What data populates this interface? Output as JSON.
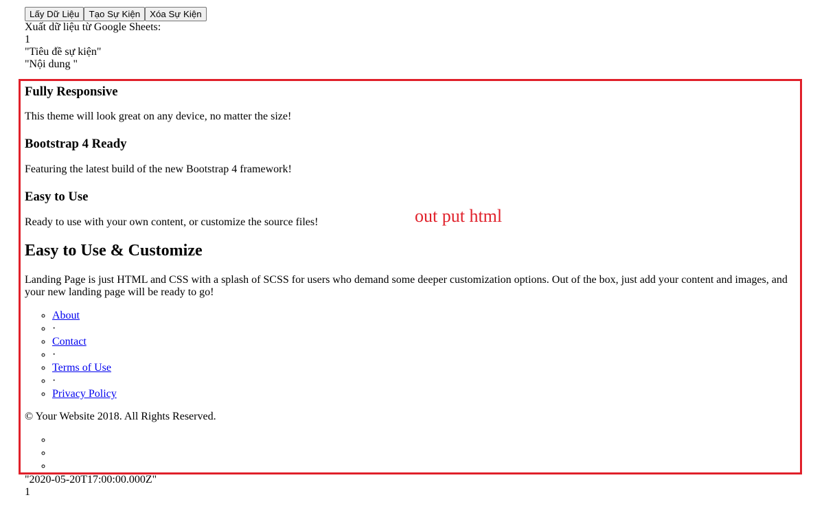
{
  "toolbar": {
    "buttons": [
      "Lấy Dữ Liệu",
      "Tạo Sự Kiện",
      "Xóa Sự Kiện"
    ]
  },
  "header_lines": [
    "Xuất dữ liệu từ Google Sheets:",
    "1",
    "\"Tiêu đề sự kiện\"",
    "\"Nội dung \""
  ],
  "content": {
    "feature1": {
      "title": "Fully Responsive",
      "text": "This theme will look great on any device, no matter the size!"
    },
    "feature2": {
      "title": "Bootstrap 4 Ready",
      "text": "Featuring the latest build of the new Bootstrap 4 framework!"
    },
    "feature3": {
      "title": "Easy to Use",
      "text": "Ready to use with your own content, or customize the source files!"
    },
    "section": {
      "title": "Easy to Use & Customize",
      "text": "Landing Page is just HTML and CSS with a splash of SCSS for users who demand some deeper customization options. Out of the box, just add your content and images, and your new landing page will be ready to go!"
    },
    "links": {
      "about": "About",
      "sep1": "·",
      "contact": "Contact",
      "sep2": "·",
      "terms": "Terms of Use",
      "sep3": "·",
      "privacy": "Privacy Policy"
    },
    "copyright": "© Your Website 2018. All Rights Reserved."
  },
  "annotation": "out put html",
  "footer_lines": [
    "\"2020-05-20T17:00:00.000Z\"",
    "1"
  ],
  "colors": {
    "frame": "#e0202a",
    "link": "#0000ee"
  }
}
